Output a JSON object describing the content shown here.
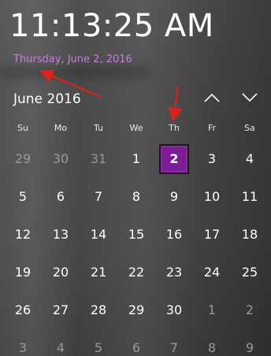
{
  "clock": {
    "time": "11:13:25 AM"
  },
  "date_link": {
    "text": "Thursday, June 2, 2016"
  },
  "calendar": {
    "month_label": "June 2016",
    "nav_up_icon": "chevron-up-icon",
    "nav_down_icon": "chevron-down-icon",
    "weekdays": [
      "Su",
      "Mo",
      "Tu",
      "We",
      "Th",
      "Fr",
      "Sa"
    ],
    "weeks": [
      [
        {
          "d": "29",
          "other": true
        },
        {
          "d": "30",
          "other": true
        },
        {
          "d": "31",
          "other": true
        },
        {
          "d": "1"
        },
        {
          "d": "2",
          "today": true
        },
        {
          "d": "3"
        },
        {
          "d": "4"
        }
      ],
      [
        {
          "d": "5"
        },
        {
          "d": "6"
        },
        {
          "d": "7"
        },
        {
          "d": "8"
        },
        {
          "d": "9"
        },
        {
          "d": "10"
        },
        {
          "d": "11"
        }
      ],
      [
        {
          "d": "12"
        },
        {
          "d": "13"
        },
        {
          "d": "14"
        },
        {
          "d": "15"
        },
        {
          "d": "16"
        },
        {
          "d": "17"
        },
        {
          "d": "18"
        }
      ],
      [
        {
          "d": "19"
        },
        {
          "d": "20"
        },
        {
          "d": "21"
        },
        {
          "d": "22"
        },
        {
          "d": "23"
        },
        {
          "d": "24"
        },
        {
          "d": "25"
        }
      ],
      [
        {
          "d": "26"
        },
        {
          "d": "27"
        },
        {
          "d": "28"
        },
        {
          "d": "29"
        },
        {
          "d": "30"
        },
        {
          "d": "1",
          "other": true
        },
        {
          "d": "2",
          "other": true
        }
      ],
      [
        {
          "d": "3",
          "other": true
        },
        {
          "d": "4",
          "other": true
        },
        {
          "d": "5",
          "other": true
        },
        {
          "d": "6",
          "other": true
        },
        {
          "d": "7",
          "other": true
        },
        {
          "d": "8",
          "other": true
        },
        {
          "d": "9",
          "other": true
        }
      ]
    ]
  },
  "colors": {
    "accent": "#7d1d96",
    "date_link": "#c77cdf",
    "annotation_arrow": "#e0201a"
  }
}
